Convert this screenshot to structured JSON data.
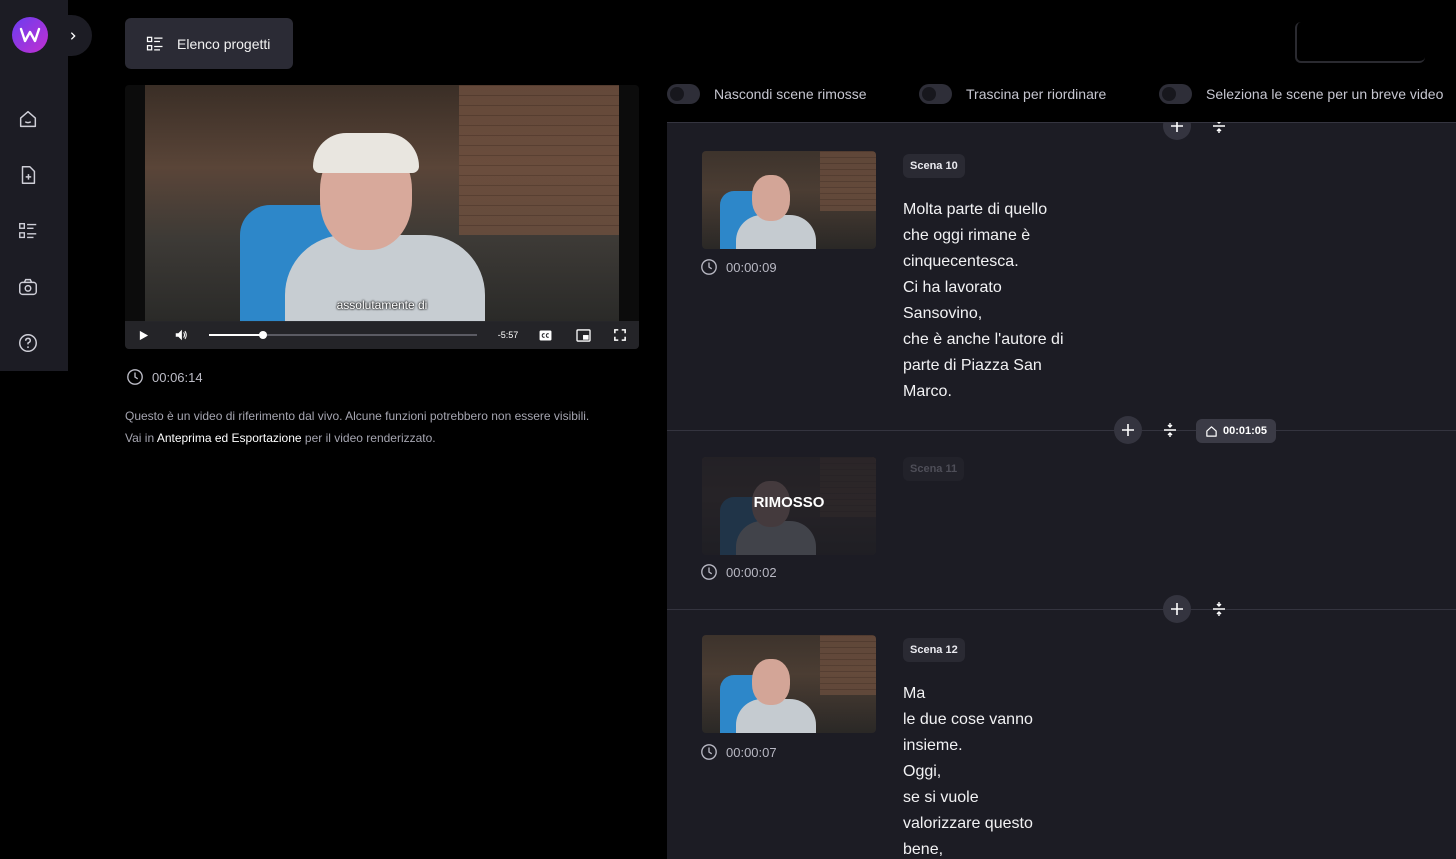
{
  "sidebar": {
    "items": [
      {
        "name": "home-icon"
      },
      {
        "name": "new-document-icon"
      },
      {
        "name": "list-icon"
      },
      {
        "name": "camera-icon"
      },
      {
        "name": "help-icon"
      }
    ]
  },
  "header": {
    "projects_label": "Elenco progetti"
  },
  "video": {
    "subtitle": "assolutamente di",
    "remaining": "-5:57",
    "progress": 0.2,
    "duration": "00:06:14"
  },
  "info": {
    "line1": "Questo è un video di riferimento dal vivo. Alcune funzioni potrebbero non essere visibili.",
    "line2_prefix": "Vai in",
    "line2_link": "Anteprima ed Esportazione",
    "line2_suffix": "per il video renderizzato."
  },
  "toggles": {
    "hide_removed": "Nascondi scene rimosse",
    "drag_reorder": "Trascina per riordinare",
    "select_short": "Seleziona le scene per un breve video"
  },
  "scenes": [
    {
      "badge": "Scena 10",
      "time": "00:00:09",
      "lines": [
        "Molta parte di quello",
        "che oggi rimane è",
        "cinquecentesca.",
        "Ci ha lavorato",
        "Sansovino,",
        "che è anche l'autore di",
        "parte di Piazza San",
        "Marco."
      ]
    },
    {
      "badge": "Scena 11",
      "time": "00:00:02",
      "removed_label": "RIMOSSO",
      "lines": []
    },
    {
      "badge": "Scena 12",
      "time": "00:00:07",
      "lines": [
        "Ma",
        "le due cose vanno",
        "insieme.",
        "Oggi,",
        "se si vuole",
        "valorizzare questo",
        "bene,"
      ]
    }
  ],
  "separator": {
    "total_duration": "00:01:05"
  },
  "colors": {
    "panel": "#1c1c24",
    "accent_logo": "#8a3ae6"
  }
}
